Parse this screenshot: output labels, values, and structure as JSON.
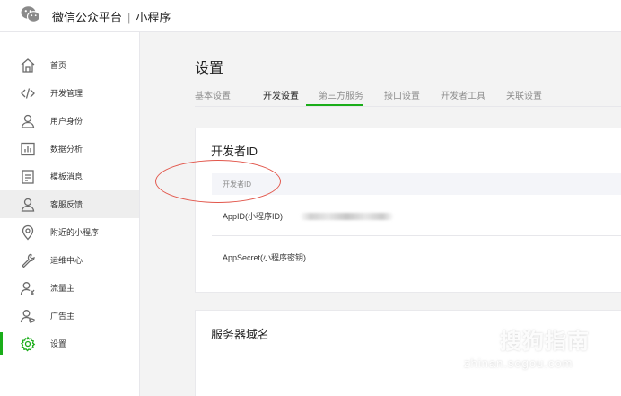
{
  "header": {
    "product": "微信公众平台",
    "separator": "|",
    "section": "小程序"
  },
  "sidebar": {
    "items": [
      {
        "label": "首页",
        "icon": "home-icon"
      },
      {
        "label": "开发管理",
        "icon": "code-icon"
      },
      {
        "label": "用户身份",
        "icon": "user-icon"
      },
      {
        "label": "数据分析",
        "icon": "chart-icon"
      },
      {
        "label": "模板消息",
        "icon": "document-icon"
      },
      {
        "label": "客服反馈",
        "icon": "user-icon"
      },
      {
        "label": "附近的小程序",
        "icon": "location-icon"
      },
      {
        "label": "运维中心",
        "icon": "wrench-icon"
      },
      {
        "label": "流量主",
        "icon": "user-money-icon"
      },
      {
        "label": "广告主",
        "icon": "user-ad-icon"
      },
      {
        "label": "设置",
        "icon": "gear-icon"
      }
    ],
    "hover_index": 5,
    "active_index": 10
  },
  "main": {
    "title": "设置",
    "tabs": [
      {
        "label": "基本设置"
      },
      {
        "label": "开发设置"
      },
      {
        "label": "第三方服务"
      },
      {
        "label": "接口设置"
      },
      {
        "label": "开发者工具"
      },
      {
        "label": "关联设置"
      }
    ],
    "active_tab_index": 1
  },
  "developer_id_card": {
    "title": "开发者ID",
    "table_header": "开发者ID",
    "rows": [
      {
        "key": "AppID(小程序ID)",
        "value_blurred": true
      },
      {
        "key": "AppSecret(小程序密钥)"
      }
    ]
  },
  "server_domain_card": {
    "title": "服务器域名"
  },
  "watermark": {
    "badge": "S",
    "text": "搜狗指南",
    "url": "zhinan.sogou.com"
  },
  "colors": {
    "accent": "#1aad19",
    "annotation": "#e2574c",
    "background": "#f3f3f3"
  }
}
